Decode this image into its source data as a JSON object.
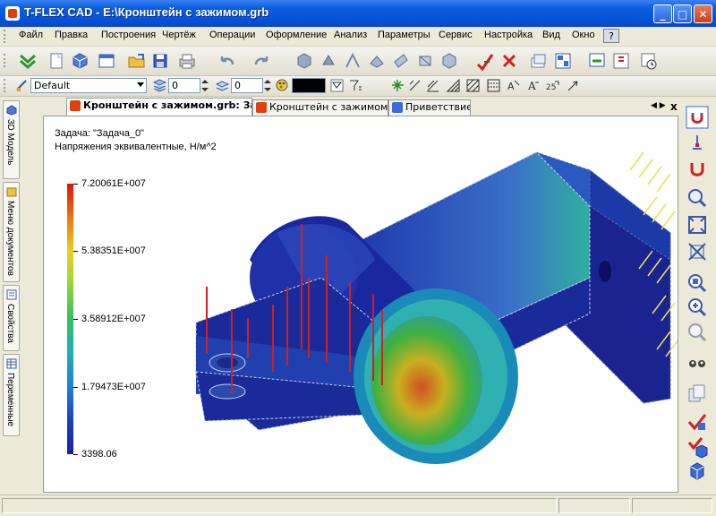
{
  "window": {
    "title": "T-FLEX CAD - E:\\Кронштейн с зажимом.grb",
    "minimize_label": "_",
    "maximize_label": "□",
    "close_label": "✕"
  },
  "menu": {
    "items": [
      "Файл",
      "Правка",
      "Построения",
      "Чертёж",
      "Операции",
      "Оформление",
      "Анализ",
      "Параметры",
      "Сервис",
      "Настройка",
      "Вид",
      "Окно"
    ],
    "help_label": "?"
  },
  "toolbar1": {
    "icons": [
      "apply-icon",
      "new-icon",
      "open-icon",
      "window-icon",
      "folder-icon",
      "save-icon",
      "print-icon",
      "undo-icon",
      "redo-icon",
      "view-3d-icon",
      "rotate-icon",
      "axis-icon",
      "face-icon",
      "plane-icon",
      "section-icon",
      "cube-icon",
      "mark-icon",
      "delete-icon",
      "layers-icon",
      "properties-icon",
      "export-icon",
      "import-icon",
      "timer-icon"
    ]
  },
  "toolbar2": {
    "style_value": "Default",
    "level_value": "0",
    "layer_value": "0",
    "color_value": "#000000"
  },
  "left_tabs": [
    {
      "label": "3D Модель",
      "icon": "model-3d-icon"
    },
    {
      "label": "Меню документов",
      "icon": "documents-menu-icon"
    },
    {
      "label": "Свойства",
      "icon": "properties-icon"
    },
    {
      "label": "Переменные",
      "icon": "variables-icon"
    }
  ],
  "doc_tabs": [
    {
      "label": "Кронштейн с зажимом.grb: Задача",
      "active": true
    },
    {
      "label": "Кронштейн с зажимом.grb",
      "active": false
    },
    {
      "label": "Приветствие",
      "active": false
    }
  ],
  "doc_tab_close_label": "x",
  "viewport": {
    "task_label": "Задача: \"Задача_0\"",
    "result_label": "Напряжения эквивалентные, Н/м^2",
    "legend_values": [
      "7.20061E+007",
      "5.38351E+007",
      "3.58912E+007",
      "1.79473E+007",
      "3398.06"
    ],
    "legend_colors": [
      "#e01010",
      "#e8d020",
      "#30c060",
      "#2080d8",
      "#1a20a0"
    ]
  },
  "right_tools": [
    "magnet-icon",
    "snap-icon",
    "attract-icon",
    "zoom-window-icon",
    "zoom-fit-icon",
    "zoom-extents-icon",
    "zoom-page-icon",
    "zoom-in-icon",
    "zoom-out-icon",
    "zoom-previous-icon",
    "view-eyes-icon",
    "copy-views-icon",
    "check-icon",
    "check-cube-icon",
    "cube-icon"
  ]
}
